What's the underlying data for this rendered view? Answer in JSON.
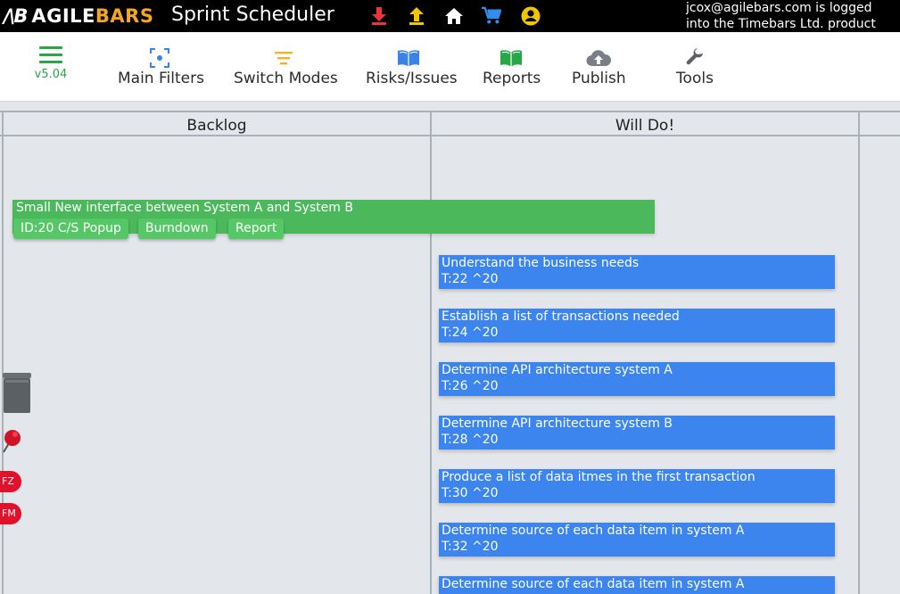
{
  "topbar": {
    "logo_mark": "/\\B",
    "logo_agile": "AGILE",
    "logo_bars": "BARS",
    "app_title": "Sprint Scheduler",
    "login_message": "jcox@agilebars.com is logged into the Timebars Ltd. product locally.",
    "icons": [
      "download-icon",
      "upload-icon",
      "home-icon",
      "cart-icon",
      "user-icon"
    ],
    "colors": {
      "download": "#e8343a",
      "upload": "#f2c500",
      "home": "#ffffff",
      "cart": "#2f8ff0",
      "user": "#f2c500"
    }
  },
  "toolbar": {
    "version": "v5.04",
    "items": [
      {
        "label": "Main Filters",
        "icon": "filter-focus-icon"
      },
      {
        "label": "Switch Modes",
        "icon": "sort-lines-icon"
      },
      {
        "label": "Risks/Issues",
        "icon": "book-open-icon"
      },
      {
        "label": "Reports",
        "icon": "book-open-icon"
      },
      {
        "label": "Publish",
        "icon": "cloud-upload-icon"
      },
      {
        "label": "Tools",
        "icon": "wrench-icon"
      }
    ]
  },
  "board": {
    "columns": [
      "Backlog",
      "Will Do!"
    ],
    "feature": {
      "title": "Small New interface between System A and System B",
      "chips": [
        "ID:20 C/S Popup",
        "Burndown",
        "Report"
      ]
    },
    "tasks": [
      {
        "title": "Understand the business needs",
        "id": "T:22 ^20"
      },
      {
        "title": "Establish a list of transactions needed",
        "id": "T:24 ^20"
      },
      {
        "title": "Determine API architecture system A",
        "id": "T:26 ^20"
      },
      {
        "title": "Determine API architecture system B",
        "id": "T:28 ^20"
      },
      {
        "title": "Produce a list of data itmes in the first transaction",
        "id": "T:30 ^20"
      },
      {
        "title": "Determine source of each data item in system A",
        "id": "T:32 ^20"
      },
      {
        "title": "Determine source of each data item in system A",
        "id": ""
      }
    ],
    "side_badges": [
      "FZ",
      "FM"
    ]
  },
  "colors": {
    "feature_green": "#4cb85c",
    "task_blue": "#3d85ee",
    "accent_green": "#27a745",
    "badge_red": "#e0112b"
  }
}
